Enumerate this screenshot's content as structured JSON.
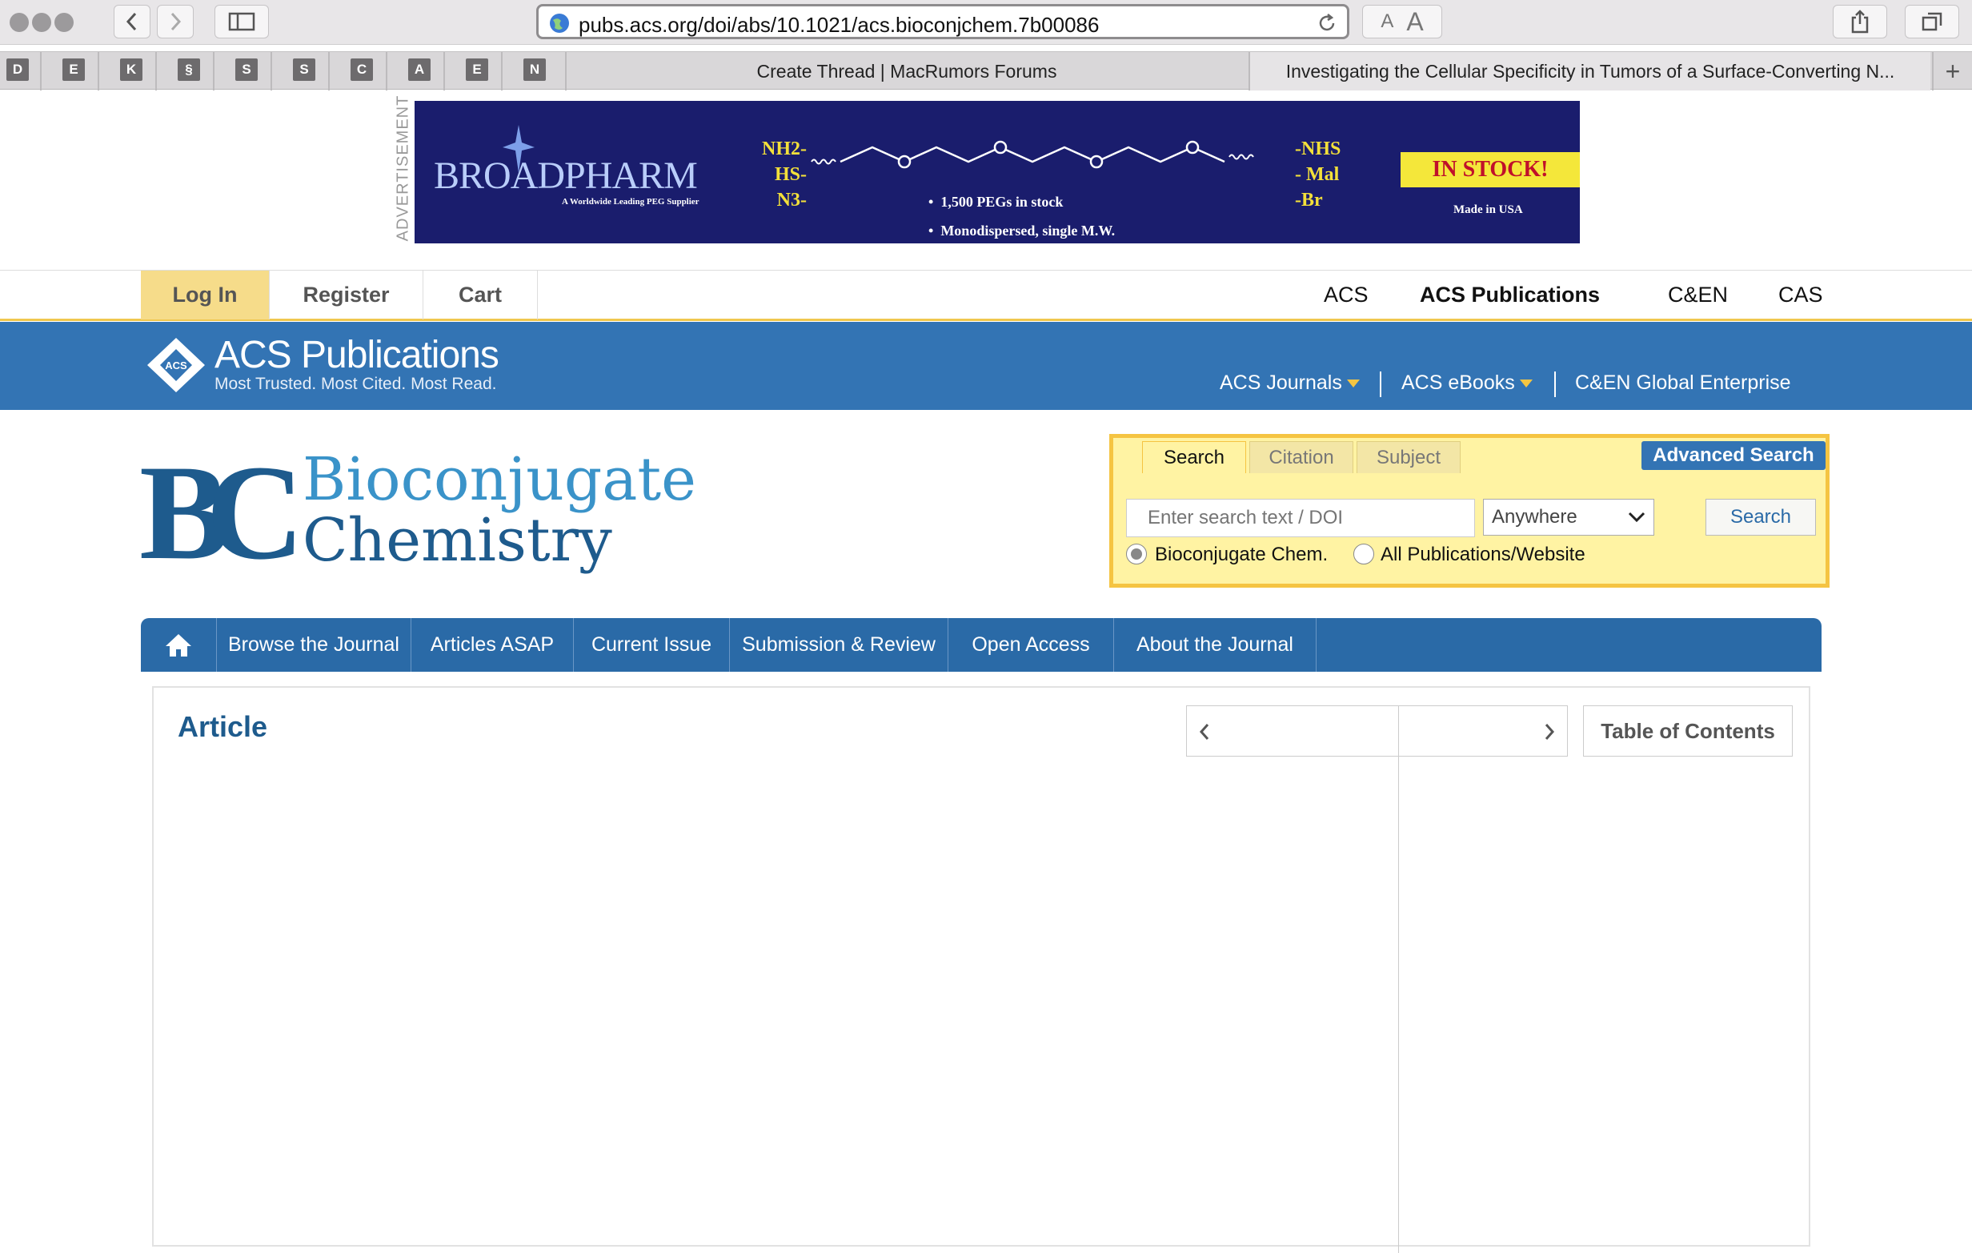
{
  "browser": {
    "url": "pubs.acs.org/doi/abs/10.1021/acs.bioconjchem.7b00086",
    "text_smaller": "A",
    "text_larger": "A",
    "favorites": [
      "D",
      "E",
      "K",
      "§",
      "S",
      "S",
      "C",
      "A",
      "E",
      "N"
    ],
    "tabs": [
      {
        "title": "Create Thread | MacRumors Forums"
      },
      {
        "title": "Investigating the Cellular Specificity in Tumors of a Surface-Converting N..."
      }
    ],
    "new_tab": "+"
  },
  "ad": {
    "label": "ADVERTISEMENT",
    "brand": "BROADPHARM",
    "brand_tagline": "A Worldwide Leading PEG Supplier",
    "left_groups": [
      "NH2-",
      "HS-",
      "N3-"
    ],
    "right_groups": [
      "-NHS",
      "- Mal",
      "-Br"
    ],
    "bullets": [
      "1,500 PEGs in stock",
      "Monodispersed, single M.W."
    ],
    "stock": "IN STOCK!",
    "made_in": "Made in USA"
  },
  "topnav": {
    "left": [
      "Log In",
      "Register",
      "Cart"
    ],
    "right": [
      "ACS",
      "ACS Publications",
      "C&EN",
      "CAS"
    ]
  },
  "acs": {
    "logo_title": "ACS Publications",
    "logo_tagline": "Most Trusted. Most Cited. Most Read.",
    "links": [
      "ACS Journals",
      "ACS eBooks",
      "C&EN Global Enterprise"
    ]
  },
  "journal": {
    "initials": "BC",
    "name_line1": "Bioconjugate",
    "name_line2": "Chemistry"
  },
  "search": {
    "tabs": [
      "Search",
      "Citation",
      "Subject"
    ],
    "advanced": "Advanced Search",
    "placeholder": "Enter search text / DOI",
    "scope": "Anywhere",
    "button": "Search",
    "radio": [
      "Bioconjugate Chem.",
      "All Publications/Website"
    ]
  },
  "journal_nav": [
    "Browse the Journal",
    "Articles ASAP",
    "Current Issue",
    "Submission & Review",
    "Open Access",
    "About the Journal"
  ],
  "article": {
    "heading": "Article",
    "toc": "Table of Contents"
  },
  "colors": {
    "acs_blue": "#3374b4",
    "journal_nav": "#2a6aa7",
    "search_yellow": "#f5c442",
    "login_tab": "#f6dc8a"
  }
}
